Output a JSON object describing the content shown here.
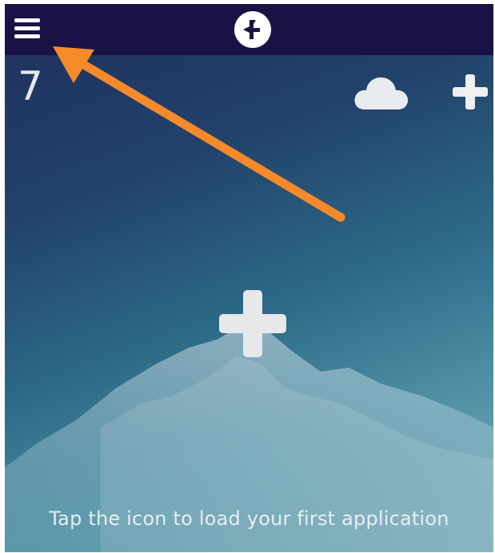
{
  "header": {
    "menu_icon": "hamburger-menu-icon",
    "logo_icon": "app-logo-icon",
    "background_color": "#1a1244"
  },
  "dashboard": {
    "app_count": "7",
    "cloud_icon": "cloud-icon",
    "add_icon": "plus-icon",
    "center_add_icon": "plus-icon",
    "empty_hint": "Tap the icon to load your first application"
  },
  "annotation": {
    "arrow_color": "#f58a2a",
    "points_to": "hamburger-menu-icon"
  }
}
